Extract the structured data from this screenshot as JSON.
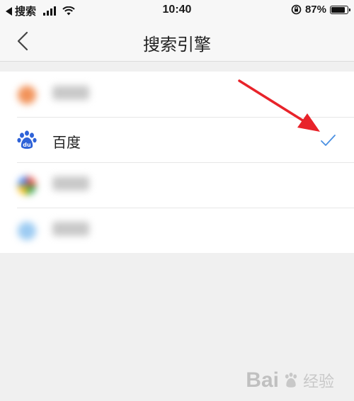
{
  "status_bar": {
    "back_app": "搜索",
    "time": "10:40",
    "battery_text": "87%",
    "battery_level": 0.87,
    "icons": [
      "signal-icon",
      "wifi-icon",
      "rotation-lock-icon",
      "battery-icon"
    ]
  },
  "nav": {
    "title": "搜索引擎",
    "back_icon": "chevron-left-icon"
  },
  "engines": [
    {
      "label": "",
      "icon": "blurred-orange-icon"
    },
    {
      "label": "百度",
      "icon": "baidu-paw-icon",
      "selected": true
    },
    {
      "label": "",
      "icon": "blurred-google-icon"
    },
    {
      "label": "",
      "icon": "blurred-blue-icon"
    }
  ],
  "colors": {
    "accent": "#4a90e2",
    "annotation_arrow": "#e8232a",
    "baidu_blue": "#2f63d8"
  },
  "watermark": {
    "text": "Bai",
    "text2": "经验"
  }
}
